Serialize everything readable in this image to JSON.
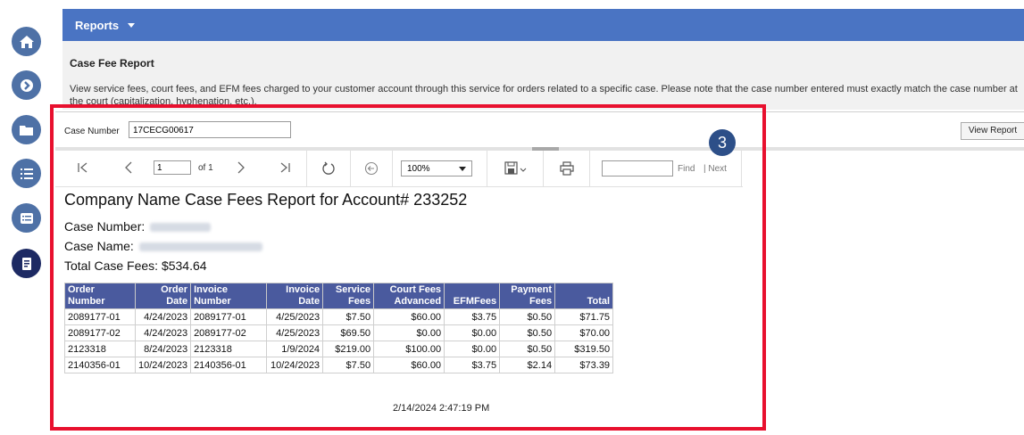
{
  "nav": {
    "icons": [
      "home-icon",
      "arrow-right-circle-icon",
      "folder-icon",
      "list-icon",
      "list-box-icon",
      "report-document-icon"
    ]
  },
  "topbar": {
    "menu_label": "Reports"
  },
  "panel": {
    "heading": "Case Fee Report",
    "description": "View service fees, court fees, and EFM fees charged to your customer account through this service for orders related to a specific case. Please note that the case number entered must exactly match the case number at the court (capitalization, hyphenation, etc.)."
  },
  "params": {
    "case_number_label": "Case Number",
    "case_number_value": "17CECG00617",
    "view_report_label": "View Report"
  },
  "toolbar": {
    "page_value": "1",
    "of_text": "of 1",
    "zoom_value": "100%",
    "find_label": "Find",
    "next_label": "| Next"
  },
  "callout_number": "3",
  "report": {
    "title": "Company Name  Case Fees Report for Account# 233252",
    "case_number_label": "Case Number:",
    "case_name_label": "Case Name:",
    "total_label": "Total Case Fees: $534.64",
    "columns": [
      "Order Number",
      "Order Date",
      "Invoice Number",
      "Invoice Date",
      "Service Fees",
      "Court Fees Advanced",
      "EFMFees",
      "Payment Fees",
      "Total"
    ],
    "rows": [
      [
        "2089177-01",
        "4/24/2023",
        "2089177-01",
        "4/25/2023",
        "$7.50",
        "$60.00",
        "$3.75",
        "$0.50",
        "$71.75"
      ],
      [
        "2089177-02",
        "4/24/2023",
        "2089177-02",
        "4/25/2023",
        "$69.50",
        "$0.00",
        "$0.00",
        "$0.50",
        "$70.00"
      ],
      [
        "2123318",
        "8/24/2023",
        "2123318",
        "1/9/2024",
        "$219.00",
        "$100.00",
        "$0.00",
        "$0.50",
        "$319.50"
      ],
      [
        "2140356-01",
        "10/24/2023",
        "2140356-01",
        "10/24/2023",
        "$7.50",
        "$60.00",
        "$3.75",
        "$2.14",
        "$73.39"
      ]
    ],
    "generated": "2/14/2024 2:47:19 PM"
  },
  "colors": {
    "accent": "#4a74c3",
    "nav": "#4e71a6",
    "nav_dark": "#1d2a63",
    "table_header": "#4a5a9e",
    "highlight": "#e8102e"
  }
}
